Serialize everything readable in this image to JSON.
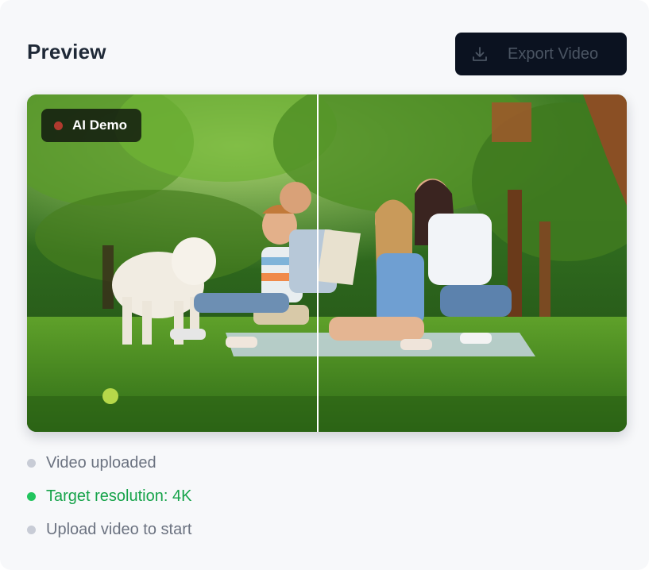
{
  "panel": {
    "title": "Preview"
  },
  "toolbar": {
    "export_label": "Export Video",
    "export_icon": "download-icon"
  },
  "preview": {
    "badge_label": "AI Demo",
    "badge_dot_color": "#b03a2e",
    "split_divider": "comparison-slider"
  },
  "status": {
    "items": [
      {
        "label": "Video uploaded",
        "color": "#c8ccd6",
        "text_color": "#6b7280"
      },
      {
        "label": "Target resolution: 4K",
        "color": "#22c55e",
        "text_color": "#16a34a"
      },
      {
        "label": "Upload video to start",
        "color": "#c8ccd6",
        "text_color": "#6b7280"
      }
    ]
  }
}
